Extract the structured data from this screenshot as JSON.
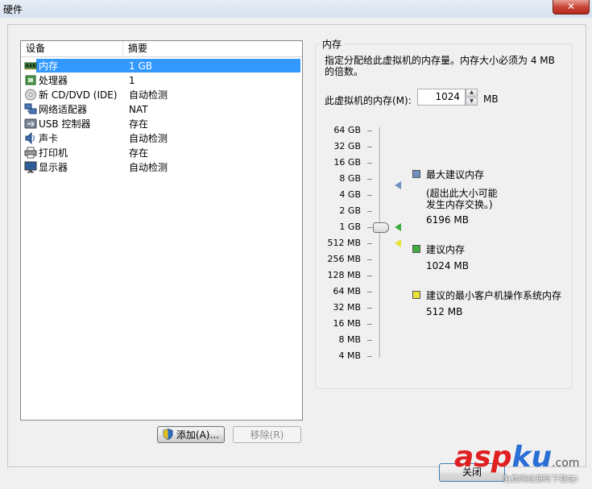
{
  "window": {
    "title": "硬件",
    "close_glyph": "✕"
  },
  "device_list": {
    "headers": {
      "device": "设备",
      "summary": "摘要"
    },
    "rows": [
      {
        "name": "内存",
        "summary": "1 GB",
        "icon": "memory-icon",
        "selected": true
      },
      {
        "name": "处理器",
        "summary": "1",
        "icon": "cpu-icon"
      },
      {
        "name": "新 CD/DVD (IDE)",
        "summary": "自动检测",
        "icon": "cd-dvd-icon"
      },
      {
        "name": "网络适配器",
        "summary": "NAT",
        "icon": "network-adapter-icon"
      },
      {
        "name": "USB 控制器",
        "summary": "存在",
        "icon": "usb-icon"
      },
      {
        "name": "声卡",
        "summary": "自动检测",
        "icon": "sound-card-icon"
      },
      {
        "name": "打印机",
        "summary": "存在",
        "icon": "printer-icon"
      },
      {
        "name": "显示器",
        "summary": "自动检测",
        "icon": "display-icon"
      }
    ]
  },
  "buttons": {
    "add": "添加(A)...",
    "remove": "移除(R)",
    "close": "关闭"
  },
  "memory": {
    "group_title": "内存",
    "description": "指定分配给此虚拟机的内存量。内存大小必须为 4 MB 的倍数。",
    "label": "此虚拟机的内存(M):",
    "value": "1024",
    "unit": "MB",
    "scale_ticks": [
      "64 GB",
      "32 GB",
      "16 GB",
      "8 GB",
      "4 GB",
      "2 GB",
      "1 GB",
      "512 MB",
      "256 MB",
      "128 MB",
      "64 MB",
      "32 MB",
      "16 MB",
      "8 MB",
      "4 MB"
    ],
    "current_position_label": "1 GB",
    "legend": {
      "max": {
        "title": "最大建议内存",
        "note_line1": "(超出此大小可能",
        "note_line2": "发生内存交换。)",
        "value": "6196 MB",
        "color": "#6f8fc0"
      },
      "recommended": {
        "title": "建议内存",
        "value": "1024 MB",
        "color": "#3fae3f"
      },
      "min": {
        "title": "建议的最小客户机操作系统内存",
        "value": "512 MB",
        "color": "#e8e23a"
      }
    }
  },
  "watermark": {
    "brand_red": "asp",
    "brand_blue": "ku",
    "tld": ".com",
    "tagline": "免费网络源码下载站!"
  }
}
